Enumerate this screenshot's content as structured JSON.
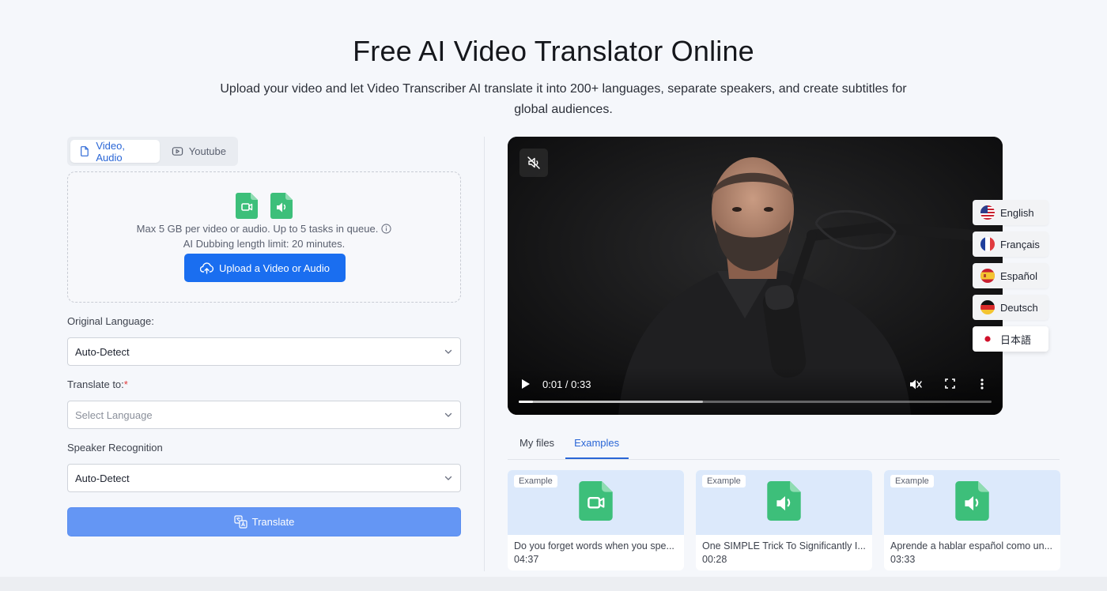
{
  "header": {
    "title": "Free AI Video Translator Online",
    "subtitle": "Upload your video and let Video Transcriber AI translate it into 200+ languages, separate speakers, and create subtitles for global audiences."
  },
  "source_tabs": [
    {
      "label": "Video, Audio",
      "icon": "file-icon",
      "active": true
    },
    {
      "label": "Youtube",
      "icon": "youtube-icon",
      "active": false
    }
  ],
  "upload": {
    "line1": "Max 5 GB per video or audio. Up to 5 tasks in queue.",
    "line2": "AI Dubbing length limit: 20 minutes.",
    "button_label": "Upload a Video or Audio"
  },
  "form": {
    "original_language_label": "Original Language:",
    "original_language_value": "Auto-Detect",
    "translate_to_label": "Translate to:",
    "translate_to_required": "*",
    "translate_to_placeholder": "Select Language",
    "speaker_label": "Speaker Recognition",
    "speaker_value": "Auto-Detect",
    "translate_button": "Translate"
  },
  "video": {
    "time_display": "0:01 / 0:33",
    "played_fraction": 0.03,
    "buffered_fraction": 0.39
  },
  "languages": [
    {
      "label": "English",
      "flag": "us"
    },
    {
      "label": "Français",
      "flag": "fr"
    },
    {
      "label": "Español",
      "flag": "es"
    },
    {
      "label": "Deutsch",
      "flag": "de"
    },
    {
      "label": "日本語",
      "flag": "jp",
      "active": true
    }
  ],
  "file_tabs": [
    {
      "label": "My files",
      "active": false
    },
    {
      "label": "Examples",
      "active": true
    }
  ],
  "examples": [
    {
      "badge": "Example",
      "icon": "video-file-icon",
      "title": "Do you forget words when you spe...",
      "duration": "04:37"
    },
    {
      "badge": "Example",
      "icon": "audio-file-icon",
      "title": "One SIMPLE Trick To Significantly I...",
      "duration": "00:28"
    },
    {
      "badge": "Example",
      "icon": "audio-file-icon",
      "title": "Aprende a hablar español como un...",
      "duration": "03:33"
    }
  ],
  "colors": {
    "primary": "#1a6ef0",
    "translate_button": "#6496f4",
    "file_icon_green": "#3dbf7a",
    "card_bg": "#dce9fb"
  }
}
